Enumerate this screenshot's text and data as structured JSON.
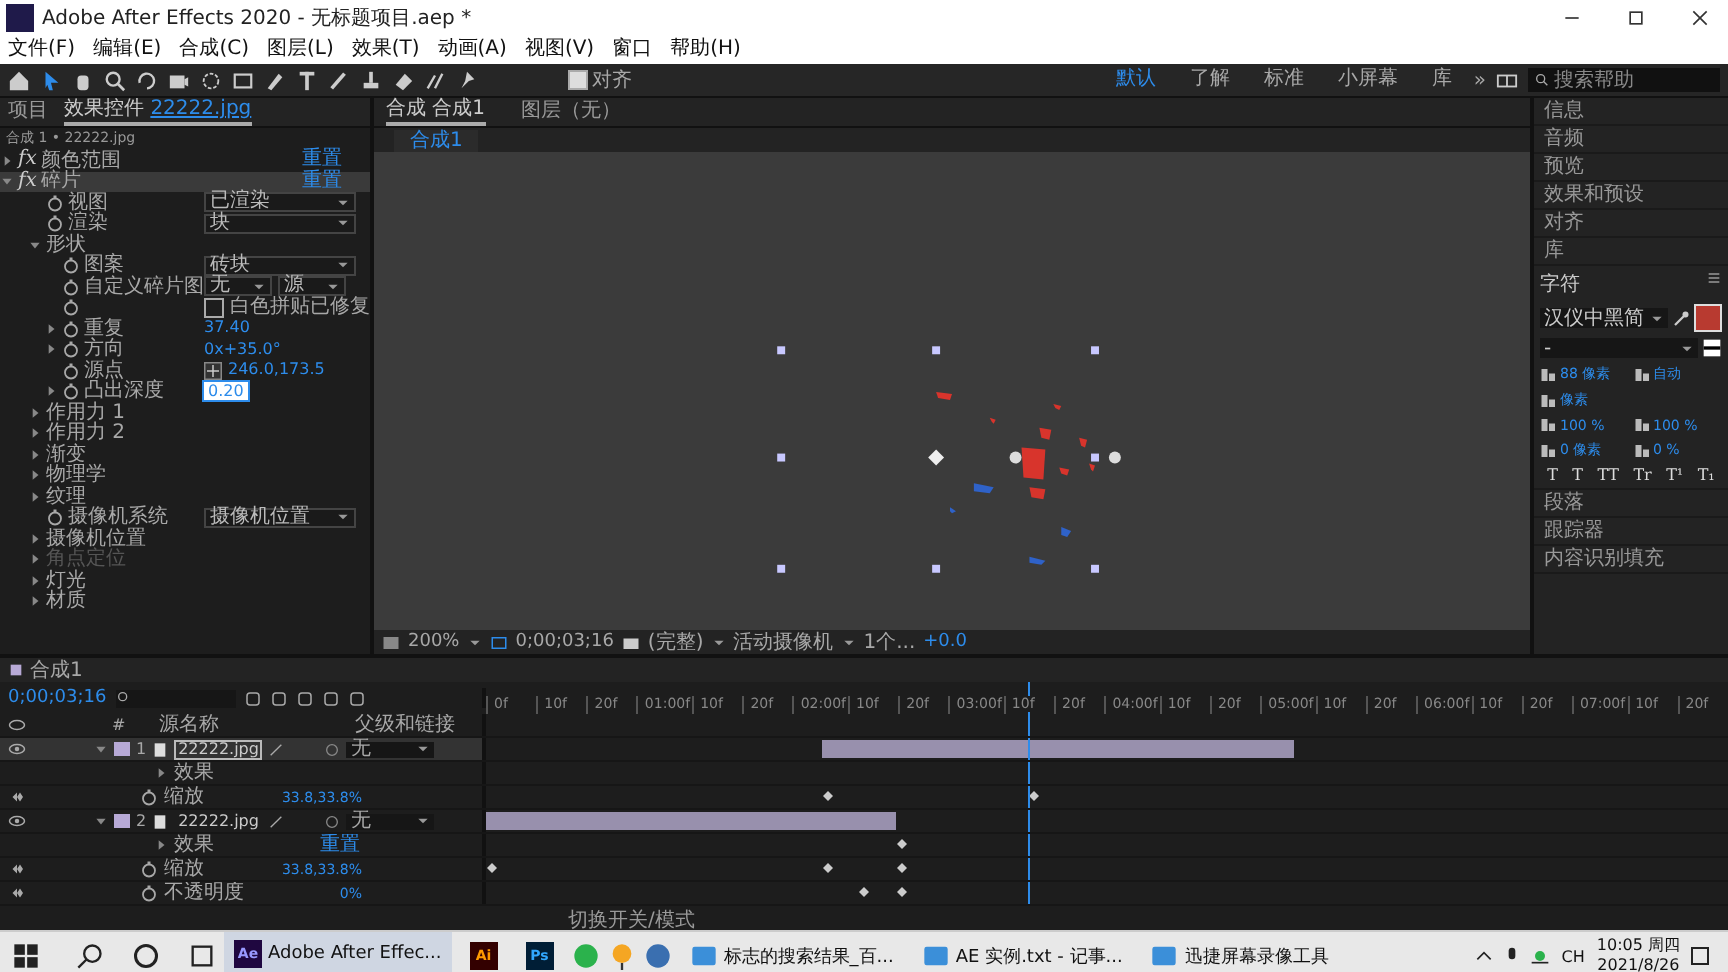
{
  "window": {
    "title": "Adobe After Effects 2020 - 无标题项目.aep *"
  },
  "menu": [
    "文件(F)",
    "编辑(E)",
    "合成(C)",
    "图层(L)",
    "效果(T)",
    "动画(A)",
    "视图(V)",
    "窗口",
    "帮助(H)"
  ],
  "toolbar": {
    "snap": {
      "label": "对齐",
      "checked": true
    },
    "workspaces": [
      {
        "label": "默认",
        "selected": true
      },
      {
        "label": "了解",
        "selected": false
      },
      {
        "label": "标准",
        "selected": false
      },
      {
        "label": "小屏幕",
        "selected": false
      },
      {
        "label": "库",
        "selected": false
      }
    ],
    "more": "»",
    "search": {
      "placeholder": "搜索帮助"
    }
  },
  "effect_controls": {
    "tabs": [
      {
        "label": "项目",
        "selected": false
      },
      {
        "label": "效果控件",
        "file": "22222.jpg",
        "selected": true
      }
    ],
    "subtitle": "合成 1 • 22222.jpg",
    "effects": [
      {
        "badge": "fx",
        "label": "颜色范围",
        "reset": "重置",
        "expanded": false,
        "selected": false
      },
      {
        "badge": "fx",
        "label": "碎片",
        "reset": "重置",
        "expanded": true,
        "selected": true,
        "children": [
          {
            "kind": "dropdown",
            "label": "视图",
            "value": "已渲染"
          },
          {
            "kind": "dropdown",
            "label": "渲染",
            "value": "块"
          },
          {
            "kind": "group",
            "label": "形状",
            "expanded": true,
            "children": [
              {
                "kind": "dropdown",
                "label": "图案",
                "value": "砖块"
              },
              {
                "kind": "dropdown2",
                "label": "自定义碎片图",
                "value": "无",
                "value2": "源"
              },
              {
                "kind": "checkbox",
                "label": "白色拼贴已修复",
                "checked": false
              },
              {
                "kind": "number",
                "label": "重复",
                "value": "37.40"
              },
              {
                "kind": "number",
                "label": "方向",
                "value": "0x+35.0°"
              },
              {
                "kind": "point",
                "label": "源点",
                "value": "246.0,173.5"
              },
              {
                "kind": "edit",
                "label": "凸出深度",
                "value": "0.20"
              }
            ]
          },
          {
            "kind": "group",
            "label": "作用力 1",
            "expanded": false
          },
          {
            "kind": "group",
            "label": "作用力 2",
            "expanded": false
          },
          {
            "kind": "group",
            "label": "渐变",
            "expanded": false
          },
          {
            "kind": "group",
            "label": "物理学",
            "expanded": false
          },
          {
            "kind": "group",
            "label": "纹理",
            "expanded": false
          },
          {
            "kind": "dropdown",
            "label": "摄像机系统",
            "value": "摄像机位置"
          },
          {
            "kind": "group",
            "label": "摄像机位置",
            "expanded": false
          },
          {
            "kind": "group",
            "label": "角点定位",
            "expanded": false,
            "disabled": true
          },
          {
            "kind": "group",
            "label": "灯光",
            "expanded": false
          },
          {
            "kind": "group",
            "label": "材质",
            "expanded": false
          }
        ]
      }
    ]
  },
  "viewer": {
    "tabs": [
      {
        "label": "合成 合成1",
        "selected": true
      },
      {
        "label": "图层（无）",
        "selected": false
      }
    ],
    "subtab": "合成1",
    "bottom_bar": {
      "zoom": "200%",
      "time": "0;00;03;16",
      "resolution": "(完整)",
      "camera": "活动摄像机",
      "views": "1个...",
      "exposure": "+0.0"
    }
  },
  "right_panel": {
    "panels": [
      {
        "kind": "collapsed",
        "label": "信息"
      },
      {
        "kind": "collapsed",
        "label": "音频"
      },
      {
        "kind": "collapsed",
        "label": "预览"
      },
      {
        "kind": "collapsed",
        "label": "效果和预设"
      },
      {
        "kind": "collapsed",
        "label": "对齐"
      },
      {
        "kind": "collapsed",
        "label": "库"
      },
      {
        "kind": "character",
        "label": "字符",
        "font": "汉仪中黑简",
        "style": "-",
        "size": "88 像素",
        "leading": "自动",
        "stroke": "像素",
        "vscale": "100 %",
        "hscale": "100 %",
        "baseline": "0 像素",
        "tsume": "0 %",
        "styles": [
          "T",
          "T",
          "TT",
          "Tr",
          "T¹",
          "T₁"
        ]
      },
      {
        "kind": "collapsed",
        "label": "段落"
      },
      {
        "kind": "collapsed",
        "label": "跟踪器"
      },
      {
        "kind": "collapsed",
        "label": "内容识别填充"
      }
    ]
  },
  "timeline": {
    "tab": "合成1",
    "time": "0;00;03;16",
    "columns": [
      "#",
      "源名称",
      "父级和链接"
    ],
    "ruler": [
      "0f",
      "10f",
      "20f",
      "01:00f",
      "10f",
      "20f",
      "02:00f",
      "10f",
      "20f",
      "03:00f",
      "10f",
      "20f",
      "04:00f",
      "10f",
      "20f",
      "05:00f",
      "10f",
      "20f",
      "06:00f",
      "10f",
      "20f",
      "07:00f",
      "10f",
      "20f"
    ],
    "layers": [
      {
        "index": "1",
        "name": "22222.jpg",
        "selected": true,
        "visible": true,
        "parent": "无",
        "children": [
          {
            "kind": "group",
            "label": "效果"
          },
          {
            "kind": "prop",
            "label": "缩放",
            "value": "33.8,33.8%"
          }
        ]
      },
      {
        "index": "2",
        "name": "22222.jpg",
        "selected": false,
        "visible": true,
        "parent": "无",
        "children": [
          {
            "kind": "group",
            "label": "效果",
            "value": "重置"
          },
          {
            "kind": "prop",
            "label": "缩放",
            "value": "33.8,33.8%"
          },
          {
            "kind": "prop",
            "label": "不透明度",
            "value": "0%"
          }
        ]
      }
    ],
    "status": "切换开关/模式"
  },
  "taskbar": {
    "apps": [
      {
        "kind": "named",
        "label": "Adobe After Effec...",
        "icon": "Ae",
        "active": true
      },
      {
        "kind": "icon",
        "icon": "Ai",
        "active": false
      },
      {
        "kind": "icon",
        "icon": "Ps",
        "active": false
      },
      {
        "kind": "named",
        "label": "标志的搜索结果_百...",
        "active": false
      },
      {
        "kind": "named",
        "label": "AE 实例.txt - 记事...",
        "active": false
      },
      {
        "kind": "named",
        "label": "迅捷屏幕录像工具",
        "active": false
      }
    ],
    "ime": "CH",
    "time": "10:05 周四",
    "date": "2021/8/26"
  }
}
